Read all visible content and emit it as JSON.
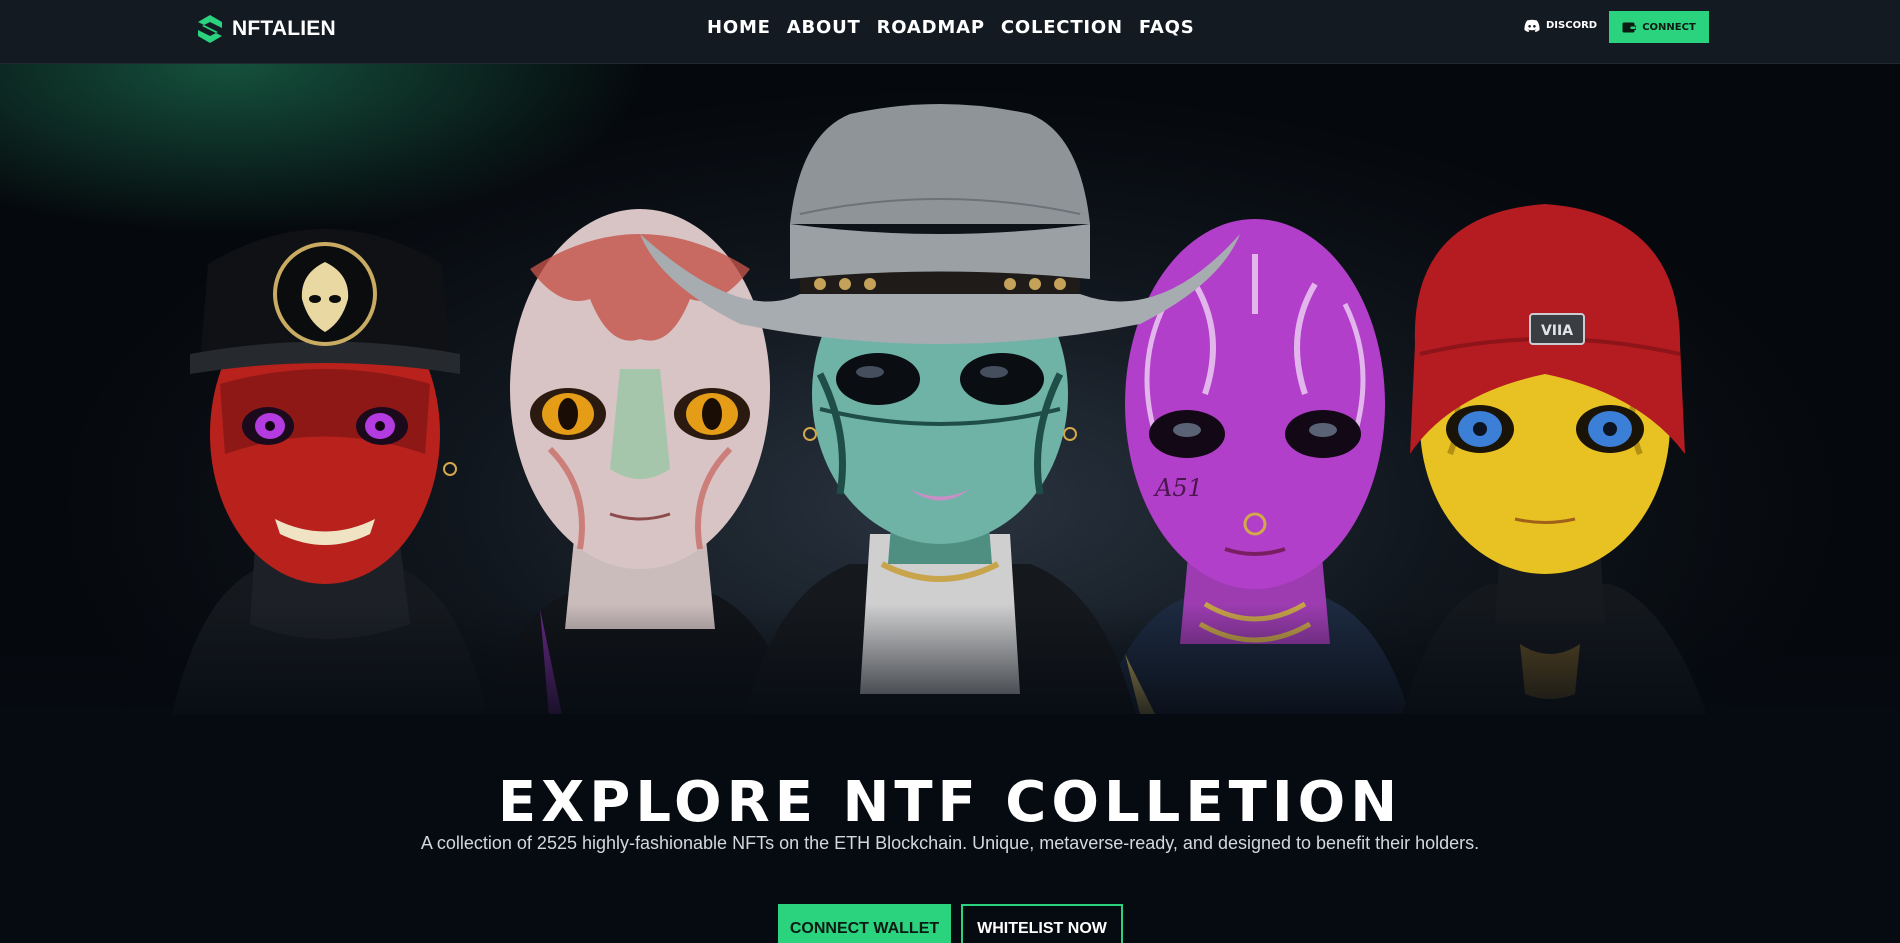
{
  "brand": {
    "name": "NFTALIEN"
  },
  "nav": {
    "items": [
      {
        "label": "HOME"
      },
      {
        "label": "ABOUT"
      },
      {
        "label": "ROADMAP"
      },
      {
        "label": "COLECTION"
      },
      {
        "label": "FAQS"
      }
    ],
    "discord_label": "DISCORD",
    "connect_label": "CONNECT"
  },
  "hero": {
    "characters": [
      {
        "skin": "red",
        "headwear": "black cap with alien emblem",
        "eyes": "purple"
      },
      {
        "skin": "pale pink",
        "headwear": "none",
        "eyes": "amber"
      },
      {
        "skin": "teal",
        "headwear": "grey cowboy hat",
        "eyes": "black"
      },
      {
        "skin": "magenta",
        "headwear": "none",
        "eyes": "black"
      },
      {
        "skin": "yellow",
        "headwear": "red beanie",
        "eyes": "blue"
      }
    ],
    "tattoo_text": "A51",
    "beanie_patch_text": "VIIA"
  },
  "headline": "EXPLORE NTF COLLETION",
  "subtitle": "A collection of 2525 highly-fashionable NFTs on the ETH Blockchain. Unique, metaverse-ready, and designed to benefit their holders.",
  "cta": {
    "connect_wallet": "CONNECT WALLET",
    "whitelist": "WHITELIST NOW"
  },
  "colors": {
    "accent": "#2bd37f",
    "nav_bg": "#131a22",
    "page_bg": "#060b12"
  },
  "icons": {
    "logo": "s-logo-icon",
    "discord": "discord-icon",
    "wallet": "wallet-icon"
  }
}
